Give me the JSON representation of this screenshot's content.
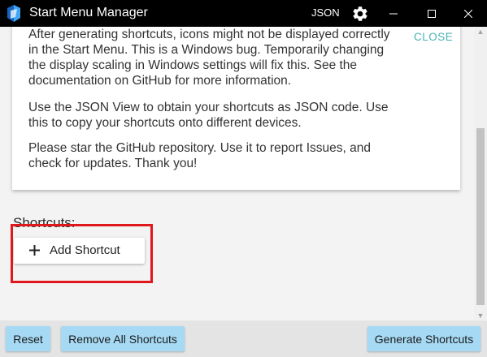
{
  "window": {
    "title": "Start Menu Manager",
    "json_label": "JSON"
  },
  "notice": {
    "paragraph_1": "After generating shortcuts, icons might not be displayed correctly in the Start Menu. This is a Windows bug. Temporarily changing the display scaling in Windows settings will fix this. See the documentation on GitHub for more information.",
    "paragraph_2": "Use the JSON View to obtain your shortcuts as JSON code. Use this to copy your shortcuts onto different devices.",
    "paragraph_3": "Please star the GitHub repository. Use it to report Issues, and check for updates. Thank you!",
    "close_label": "CLOSE"
  },
  "shortcuts": {
    "section_title": "Shortcuts:",
    "add_label": "Add Shortcut"
  },
  "footer": {
    "reset_label": "Reset",
    "remove_all_label": "Remove All Shortcuts",
    "generate_label": "Generate Shortcuts"
  },
  "colors": {
    "titlebar": "#000000",
    "accent_link": "#48b3b3",
    "footer_button": "#a6daf4",
    "highlight_box": "#e0181b"
  },
  "icons": [
    "app-logo-icon",
    "gear-icon",
    "minimize-icon",
    "maximize-icon",
    "close-icon",
    "plus-icon"
  ]
}
